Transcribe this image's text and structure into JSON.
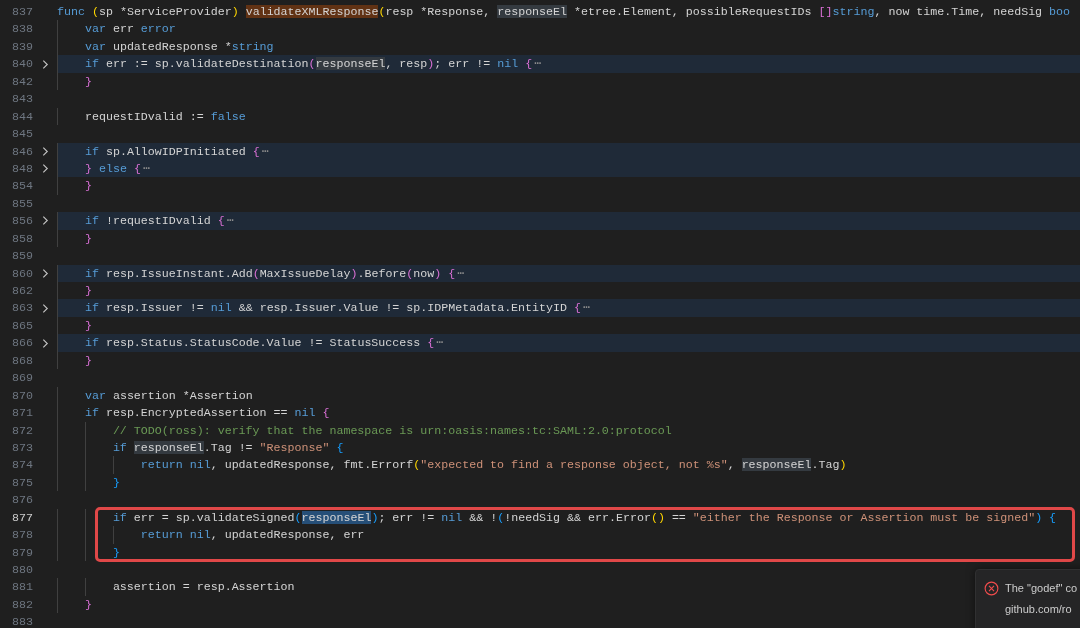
{
  "lines": [
    {
      "number": "837",
      "folded": false,
      "current": false,
      "boxed": false,
      "tokens": [
        {
          "kind": "kw",
          "text": "func"
        },
        {
          "kind": "b1",
          "text": " ("
        },
        {
          "kind": "plain",
          "text": "sp *ServiceProvider"
        },
        {
          "kind": "b1",
          "text": ") "
        },
        {
          "kind": "match",
          "text": "validateXMLResponse"
        },
        {
          "kind": "b1",
          "text": "("
        },
        {
          "kind": "plain",
          "text": "resp *Response, "
        },
        {
          "kind": "occurrence",
          "text": "responseEl"
        },
        {
          "kind": "plain",
          "text": " *etree.Element, possibleRequestIDs "
        },
        {
          "kind": "b2",
          "text": "[]"
        },
        {
          "kind": "kw",
          "text": "string"
        },
        {
          "kind": "plain",
          "text": ", now time.Time, needSig "
        },
        {
          "kind": "kw",
          "text": "boo"
        }
      ]
    },
    {
      "number": "838",
      "folded": false,
      "current": false,
      "boxed": false,
      "tokens": [
        {
          "kind": "kw",
          "text": "    var"
        },
        {
          "kind": "plain",
          "text": " err "
        },
        {
          "kind": "kw",
          "text": "error"
        }
      ]
    },
    {
      "number": "839",
      "folded": false,
      "current": false,
      "boxed": false,
      "tokens": [
        {
          "kind": "kw",
          "text": "    var"
        },
        {
          "kind": "plain",
          "text": " updatedResponse *"
        },
        {
          "kind": "kw",
          "text": "string"
        }
      ]
    },
    {
      "number": "840",
      "folded": true,
      "current": false,
      "boxed": false,
      "tokens": [
        {
          "kind": "kw",
          "text": "    if"
        },
        {
          "kind": "plain",
          "text": " err := sp.validateDestination"
        },
        {
          "kind": "b2",
          "text": "("
        },
        {
          "kind": "occurrence",
          "text": "responseEl"
        },
        {
          "kind": "plain",
          "text": ", resp"
        },
        {
          "kind": "b2",
          "text": ")"
        },
        {
          "kind": "plain",
          "text": "; err != "
        },
        {
          "kind": "kw",
          "text": "nil"
        },
        {
          "kind": "b2",
          "text": " {"
        },
        {
          "kind": "fold",
          "text": "⋯"
        }
      ]
    },
    {
      "number": "842",
      "folded": false,
      "current": false,
      "boxed": false,
      "tokens": [
        {
          "kind": "b2",
          "text": "    }"
        }
      ]
    },
    {
      "number": "843",
      "folded": false,
      "current": false,
      "boxed": false
    },
    {
      "number": "844",
      "folded": false,
      "current": false,
      "boxed": false,
      "tokens": [
        {
          "kind": "plain",
          "text": "    requestIDvalid := "
        },
        {
          "kind": "kw",
          "text": "false"
        }
      ]
    },
    {
      "number": "845",
      "folded": false,
      "current": false,
      "boxed": false
    },
    {
      "number": "846",
      "folded": true,
      "current": false,
      "boxed": false,
      "tokens": [
        {
          "kind": "kw",
          "text": "    if"
        },
        {
          "kind": "plain",
          "text": " sp.AllowIDPInitiated "
        },
        {
          "kind": "b2",
          "text": "{"
        },
        {
          "kind": "fold",
          "text": "⋯"
        }
      ]
    },
    {
      "number": "848",
      "folded": true,
      "current": false,
      "boxed": false,
      "tokens": [
        {
          "kind": "b2",
          "text": "    }"
        },
        {
          "kind": "kw",
          "text": " else"
        },
        {
          "kind": "b2",
          "text": " {"
        },
        {
          "kind": "fold",
          "text": "⋯"
        }
      ]
    },
    {
      "number": "854",
      "folded": false,
      "current": false,
      "boxed": false,
      "tokens": [
        {
          "kind": "b2",
          "text": "    }"
        }
      ]
    },
    {
      "number": "855",
      "folded": false,
      "current": false,
      "boxed": false
    },
    {
      "number": "856",
      "folded": true,
      "current": false,
      "boxed": false,
      "tokens": [
        {
          "kind": "kw",
          "text": "    if"
        },
        {
          "kind": "plain",
          "text": " !requestIDvalid "
        },
        {
          "kind": "b2",
          "text": "{"
        },
        {
          "kind": "fold",
          "text": "⋯"
        }
      ]
    },
    {
      "number": "858",
      "folded": false,
      "current": false,
      "boxed": false,
      "tokens": [
        {
          "kind": "b2",
          "text": "    }"
        }
      ]
    },
    {
      "number": "859",
      "folded": false,
      "current": false,
      "boxed": false
    },
    {
      "number": "860",
      "folded": true,
      "current": false,
      "boxed": false,
      "tokens": [
        {
          "kind": "kw",
          "text": "    if"
        },
        {
          "kind": "plain",
          "text": " resp.IssueInstant.Add"
        },
        {
          "kind": "b2",
          "text": "("
        },
        {
          "kind": "plain",
          "text": "MaxIssueDelay"
        },
        {
          "kind": "b2",
          "text": ")"
        },
        {
          "kind": "plain",
          "text": ".Before"
        },
        {
          "kind": "b2",
          "text": "("
        },
        {
          "kind": "plain",
          "text": "now"
        },
        {
          "kind": "b2",
          "text": ") {"
        },
        {
          "kind": "fold",
          "text": "⋯"
        }
      ]
    },
    {
      "number": "862",
      "folded": false,
      "current": false,
      "boxed": false,
      "tokens": [
        {
          "kind": "b2",
          "text": "    }"
        }
      ]
    },
    {
      "number": "863",
      "folded": true,
      "current": false,
      "boxed": false,
      "tokens": [
        {
          "kind": "kw",
          "text": "    if"
        },
        {
          "kind": "plain",
          "text": " resp.Issuer != "
        },
        {
          "kind": "kw",
          "text": "nil"
        },
        {
          "kind": "plain",
          "text": " && resp.Issuer.Value != sp.IDPMetadata.EntityID "
        },
        {
          "kind": "b2",
          "text": "{"
        },
        {
          "kind": "fold",
          "text": "⋯"
        }
      ]
    },
    {
      "number": "865",
      "folded": false,
      "current": false,
      "boxed": false,
      "tokens": [
        {
          "kind": "b2",
          "text": "    }"
        }
      ]
    },
    {
      "number": "866",
      "folded": true,
      "current": false,
      "boxed": false,
      "tokens": [
        {
          "kind": "kw",
          "text": "    if"
        },
        {
          "kind": "plain",
          "text": " resp.Status.StatusCode.Value != StatusSuccess "
        },
        {
          "kind": "b2",
          "text": "{"
        },
        {
          "kind": "fold",
          "text": "⋯"
        }
      ]
    },
    {
      "number": "868",
      "folded": false,
      "current": false,
      "boxed": false,
      "tokens": [
        {
          "kind": "b2",
          "text": "    }"
        }
      ]
    },
    {
      "number": "869",
      "folded": false,
      "current": false,
      "boxed": false
    },
    {
      "number": "870",
      "folded": false,
      "current": false,
      "boxed": false,
      "tokens": [
        {
          "kind": "kw",
          "text": "    var"
        },
        {
          "kind": "plain",
          "text": " assertion *Assertion"
        }
      ]
    },
    {
      "number": "871",
      "folded": false,
      "current": false,
      "boxed": false,
      "tokens": [
        {
          "kind": "kw",
          "text": "    if"
        },
        {
          "kind": "plain",
          "text": " resp.EncryptedAssertion == "
        },
        {
          "kind": "kw",
          "text": "nil"
        },
        {
          "kind": "b2",
          "text": " {"
        }
      ]
    },
    {
      "number": "872",
      "folded": false,
      "current": false,
      "boxed": false,
      "tokens": [
        {
          "kind": "cmt",
          "text": "        // TODO(ross): verify that the namespace is urn:oasis:names:tc:SAML:2.0:protocol"
        }
      ]
    },
    {
      "number": "873",
      "folded": false,
      "current": false,
      "boxed": false,
      "tokens": [
        {
          "kind": "kw",
          "text": "        if "
        },
        {
          "kind": "occurrence",
          "text": "responseEl"
        },
        {
          "kind": "plain",
          "text": ".Tag != "
        },
        {
          "kind": "str",
          "text": "\"Response\""
        },
        {
          "kind": "b3",
          "text": " {"
        }
      ]
    },
    {
      "number": "874",
      "folded": false,
      "current": false,
      "boxed": false,
      "tokens": [
        {
          "kind": "kw",
          "text": "            return nil"
        },
        {
          "kind": "plain",
          "text": ", updatedResponse, fmt.Errorf"
        },
        {
          "kind": "b1",
          "text": "("
        },
        {
          "kind": "str",
          "text": "\"expected to find a response object, not %s\""
        },
        {
          "kind": "plain",
          "text": ", "
        },
        {
          "kind": "occurrence",
          "text": "responseEl"
        },
        {
          "kind": "plain",
          "text": ".Tag"
        },
        {
          "kind": "b1",
          "text": ")"
        }
      ]
    },
    {
      "number": "875",
      "folded": false,
      "current": false,
      "boxed": false,
      "tokens": [
        {
          "kind": "b3",
          "text": "        }"
        }
      ]
    },
    {
      "number": "876",
      "folded": false,
      "current": false,
      "boxed": false
    },
    {
      "number": "877",
      "folded": false,
      "current": true,
      "boxed": true,
      "tokens": [
        {
          "kind": "kw",
          "text": "        if"
        },
        {
          "kind": "plain",
          "text": " err = sp.validateSigned"
        },
        {
          "kind": "b3",
          "text": "("
        },
        {
          "kind": "selection",
          "text": "responseEl"
        },
        {
          "kind": "b3",
          "text": ")"
        },
        {
          "kind": "plain",
          "text": "; err != "
        },
        {
          "kind": "kw",
          "text": "nil"
        },
        {
          "kind": "plain",
          "text": " && !"
        },
        {
          "kind": "b3",
          "text": "("
        },
        {
          "kind": "plain",
          "text": "!needSig && err.Error"
        },
        {
          "kind": "b1",
          "text": "()"
        },
        {
          "kind": "plain",
          "text": " == "
        },
        {
          "kind": "str",
          "text": "\"either the Response or Assertion must be signed\""
        },
        {
          "kind": "b3",
          "text": ") {"
        }
      ]
    },
    {
      "number": "878",
      "folded": false,
      "current": false,
      "boxed": true,
      "tokens": [
        {
          "kind": "kw",
          "text": "            return nil"
        },
        {
          "kind": "plain",
          "text": ", updatedResponse, err"
        }
      ]
    },
    {
      "number": "879",
      "folded": false,
      "current": false,
      "boxed": true,
      "tokens": [
        {
          "kind": "b3",
          "text": "        }"
        }
      ]
    },
    {
      "number": "880",
      "folded": false,
      "current": false,
      "boxed": false
    },
    {
      "number": "881",
      "folded": false,
      "current": false,
      "boxed": false,
      "tokens": [
        {
          "kind": "plain",
          "text": "        assertion = resp.Assertion"
        }
      ]
    },
    {
      "number": "882",
      "folded": false,
      "current": false,
      "boxed": false,
      "tokens": [
        {
          "kind": "b2",
          "text": "    }"
        }
      ]
    },
    {
      "number": "883",
      "folded": false,
      "current": false,
      "boxed": false
    }
  ],
  "notification": {
    "kind": "error",
    "lines": [
      "The \"godef\" co",
      "github.com/ro"
    ]
  }
}
